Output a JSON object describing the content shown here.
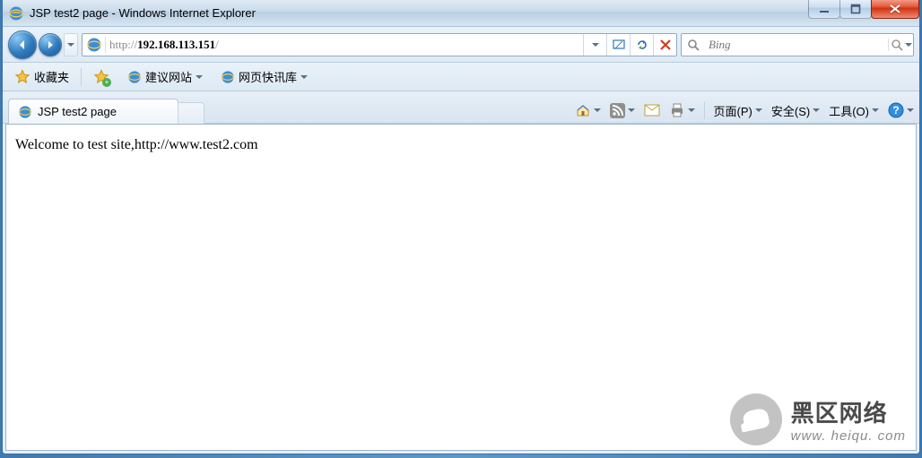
{
  "window": {
    "title": "JSP test2 page - Windows Internet Explorer"
  },
  "nav": {
    "url_prefix": "http://",
    "url_host": "192.168.113.151",
    "url_path": "/"
  },
  "search": {
    "placeholder": "Bing"
  },
  "favorites": {
    "label": "收藏夹",
    "suggested": "建议网站",
    "webslice": "网页快讯库"
  },
  "tab": {
    "title": "JSP test2 page"
  },
  "commandbar": {
    "page": "页面(P)",
    "safety": "安全(S)",
    "tools": "工具(O)"
  },
  "page": {
    "body": "Welcome to test site,http://www.test2.com"
  },
  "watermark": {
    "line1": "黑区网络",
    "line2": "www. heiqu. com"
  }
}
